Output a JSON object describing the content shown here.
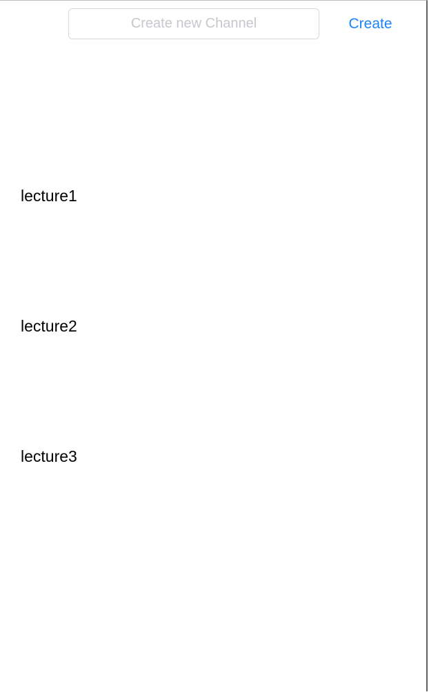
{
  "header": {
    "channel_input": {
      "placeholder": "Create new Channel",
      "value": ""
    },
    "create_label": "Create"
  },
  "channels": [
    {
      "name": "lecture1"
    },
    {
      "name": "lecture2"
    },
    {
      "name": "lecture3"
    }
  ],
  "colors": {
    "accent": "#1a82fb",
    "placeholder": "#c7c7cd",
    "text": "#000000",
    "background": "#ffffff"
  }
}
